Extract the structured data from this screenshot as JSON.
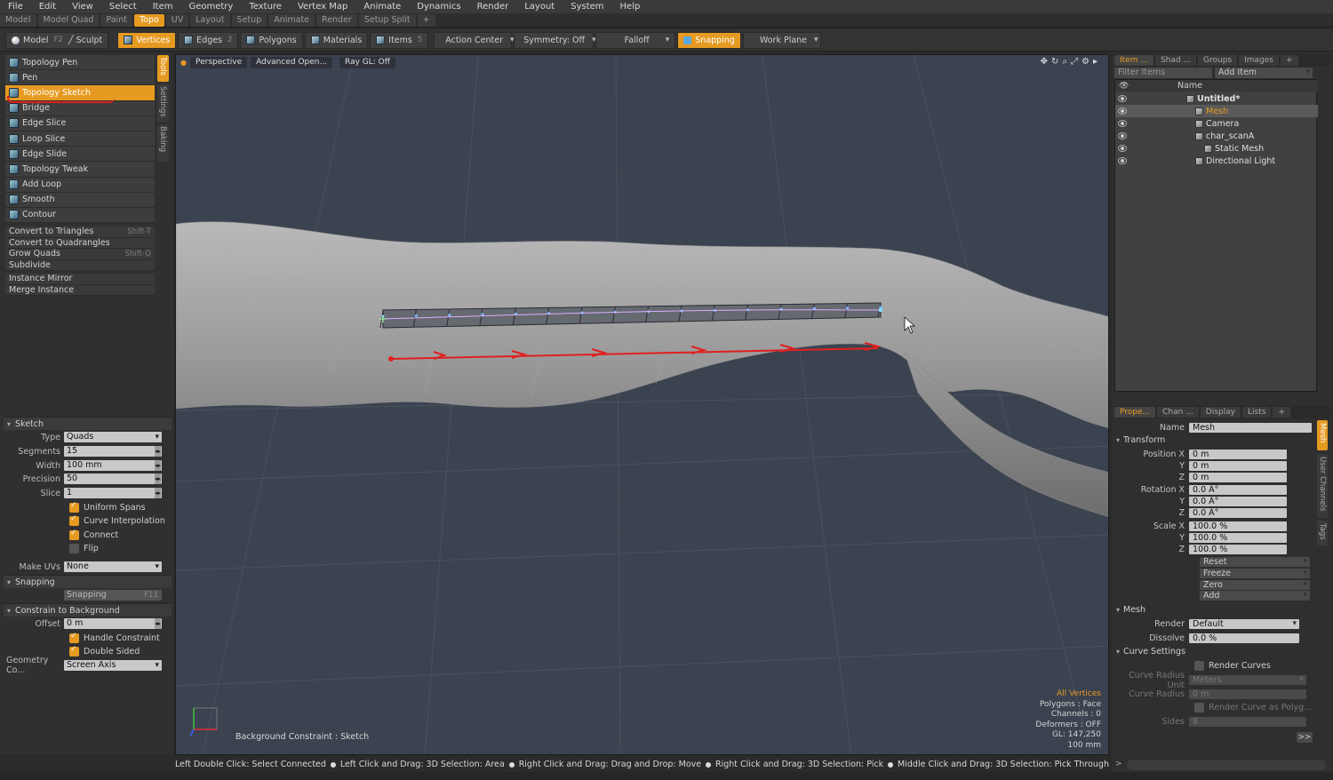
{
  "menu": [
    "File",
    "Edit",
    "View",
    "Select",
    "Item",
    "Geometry",
    "Texture",
    "Vertex Map",
    "Animate",
    "Dynamics",
    "Render",
    "Layout",
    "System",
    "Help"
  ],
  "layout_tabs": [
    {
      "label": "Model",
      "active": false
    },
    {
      "label": "Model Quad",
      "active": false
    },
    {
      "label": "Paint",
      "active": false
    },
    {
      "label": "Topo",
      "active": true
    },
    {
      "label": "UV",
      "active": false
    },
    {
      "label": "Layout",
      "active": false
    },
    {
      "label": "Setup",
      "active": false
    },
    {
      "label": "Animate",
      "active": false
    },
    {
      "label": "Render",
      "active": false
    },
    {
      "label": "Setup Split",
      "active": false
    },
    {
      "label": "+",
      "active": false
    }
  ],
  "toolbar": {
    "model_label": "Model",
    "model_key": "F2",
    "sculpt_label": "Sculpt",
    "vertices_label": "Vertices",
    "edges_label": "Edges",
    "edges_key": "2",
    "polygons_label": "Polygons",
    "materials_label": "Materials",
    "items_label": "Items",
    "items_key": "5",
    "action_center_label": "Action Center",
    "symmetry_label": "Symmetry: Off",
    "falloff_label": "Falloff",
    "snapping_label": "Snapping",
    "work_plane_label": "Work Plane"
  },
  "tools": [
    {
      "label": "Topology Pen",
      "active": false
    },
    {
      "label": "Pen",
      "active": false
    },
    {
      "label": "Topology Sketch",
      "active": true
    },
    {
      "label": "Bridge",
      "active": false
    },
    {
      "label": "Edge Slice",
      "active": false
    },
    {
      "label": "Loop Slice",
      "active": false
    },
    {
      "label": "Edge Slide",
      "active": false
    },
    {
      "label": "Topology Tweak",
      "active": false
    },
    {
      "label": "Add Loop",
      "active": false
    },
    {
      "label": "Smooth",
      "active": false
    },
    {
      "label": "Contour",
      "active": false
    }
  ],
  "commands": [
    {
      "label": "Convert to Triangles",
      "key": "Shift-T"
    },
    {
      "label": "Convert to Quadrangles",
      "key": ""
    },
    {
      "label": "Grow Quads",
      "key": "Shift-Q"
    },
    {
      "label": "Subdivide",
      "key": ""
    }
  ],
  "commands2": [
    {
      "label": "Instance Mirror"
    },
    {
      "label": "Merge Instance"
    }
  ],
  "left_vtabs": [
    "Tools",
    "Settings",
    "Baking"
  ],
  "sketch": {
    "section": "Sketch",
    "type_label": "Type",
    "type_value": "Quads",
    "segments_label": "Segments",
    "segments_value": "15",
    "width_label": "Width",
    "width_value": "100 mm",
    "precision_label": "Precision",
    "precision_value": "50",
    "slice_label": "Slice",
    "slice_value": "1",
    "uniform_spans": "Uniform Spans",
    "curve_interp": "Curve Interpolation",
    "connect": "Connect",
    "flip": "Flip",
    "make_uvs_label": "Make UVs",
    "make_uvs_value": "None",
    "snapping_section": "Snapping",
    "snapping_btn": "Snapping",
    "snapping_key": "F11",
    "constrain_section": "Constrain to Background",
    "offset_label": "Offset",
    "offset_value": "0 m",
    "handle_constraint": "Handle Constraint",
    "double_sided": "Double Sided",
    "geo_co_label": "Geometry Co...",
    "geo_co_value": "Screen Axis"
  },
  "viewport": {
    "perspective": "Perspective",
    "advanced": "Advanced Open...",
    "raygl": "Ray GL: Off",
    "stats_title": "All Vertices",
    "stats": [
      "Polygons : Face",
      "Channels : 0",
      "Deformers : OFF",
      "GL: 147,250",
      "100 mm"
    ],
    "bg_constraint": "Background Constraint  : Sketch",
    "segments": 15
  },
  "status": [
    "Left Double Click: Select Connected",
    "Left Click and Drag: 3D Selection: Area",
    "Right Click and Drag: Drag and Drop: Move",
    "Right Click and Drag: 3D Selection: Pick",
    "Middle Click and Drag: 3D Selection: Pick Through"
  ],
  "right_tabs": [
    "Item ...",
    "Shad ...",
    "Groups",
    "Images",
    "+"
  ],
  "filter_items": "Filter Items",
  "add_item": "Add Item",
  "name_col": "Name",
  "items": [
    {
      "label": "Untitled*",
      "bold": true,
      "indent": 0
    },
    {
      "label": "Mesh",
      "bold": false,
      "indent": 1,
      "selected": true
    },
    {
      "label": "Camera",
      "bold": false,
      "indent": 1
    },
    {
      "label": "char_scanA",
      "bold": false,
      "indent": 1
    },
    {
      "label": "Static Mesh",
      "bold": false,
      "indent": 2
    },
    {
      "label": "Directional Light",
      "bold": false,
      "indent": 1
    }
  ],
  "prop_tabs": [
    "Prope...",
    "Chan ...",
    "Display",
    "Lists",
    "+"
  ],
  "prop_vtabs": [
    "Mesh",
    "User Channels",
    "Tags"
  ],
  "props": {
    "name_label": "Name",
    "name_value": "Mesh",
    "transform": "Transform",
    "pos_label": "Position X",
    "px": "0 m",
    "py": "0 m",
    "pz": "0 m",
    "rot_label": "Rotation X",
    "rx": "0.0 Â°",
    "ry": "0.0 Â°",
    "rz": "0.0 Â°",
    "scale_label": "Scale X",
    "sx": "100.0 %",
    "sy": "100.0 %",
    "sz": "100.0 %",
    "y": "Y",
    "z": "Z",
    "reset": "Reset",
    "freeze": "Freeze",
    "zero": "Zero",
    "add": "Add",
    "mesh_section": "Mesh",
    "render_label": "Render",
    "render_value": "Default",
    "dissolve_label": "Dissolve",
    "dissolve_value": "0.0 %",
    "curve_section": "Curve Settings",
    "render_curves": "Render Curves",
    "radius_unit_label": "Curve Radius Unit",
    "radius_unit_value": "Meters",
    "radius_label": "Curve Radius",
    "radius_value": "0 m",
    "render_as_poly": "Render Curve as Polyg...",
    "sides_label": "Sides",
    "sides_value": "8",
    "more": ">>"
  },
  "colors": {
    "accent": "#e69a21",
    "annotation": "#e02020",
    "viewport_bg": "#3c4350"
  }
}
